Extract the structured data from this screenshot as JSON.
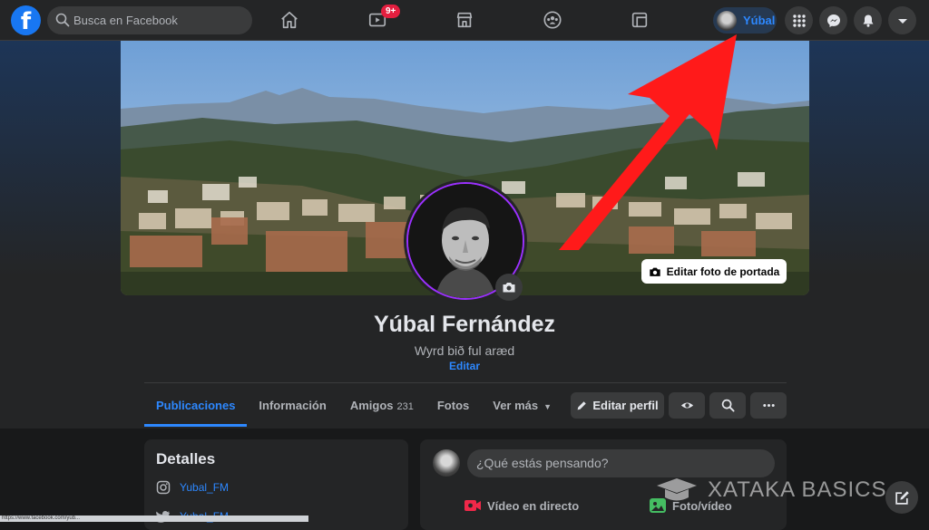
{
  "topbar": {
    "logo_letter": "f",
    "search_placeholder": "Busca en Facebook",
    "watch_badge": "9+",
    "profile_name": "Yúbal"
  },
  "cover": {
    "edit_button": "Editar foto de portada"
  },
  "profile": {
    "name": "Yúbal Fernández",
    "bio": "Wyrd bið ful aræd",
    "bio_edit": "Editar"
  },
  "tabs": [
    {
      "label": "Publicaciones",
      "active": true
    },
    {
      "label": "Información"
    },
    {
      "label": "Amigos",
      "count": "231"
    },
    {
      "label": "Fotos"
    },
    {
      "label": "Ver más"
    }
  ],
  "actions": {
    "edit_profile": "Editar perfil"
  },
  "details": {
    "title": "Detalles",
    "instagram": "Yubal_FM",
    "twitter": "Yubal_FM"
  },
  "composer": {
    "placeholder": "¿Qué estás pensando?",
    "live_video": "Vídeo en directo",
    "photo_video": "Foto/vídeo"
  },
  "watermark": "XATAKA BASICS",
  "status_url": "https://www.facebook.com/yub...",
  "colors": {
    "accent": "#2d88ff",
    "background": "#18191a",
    "surface": "#242526",
    "arrow": "#ff1a1a"
  }
}
